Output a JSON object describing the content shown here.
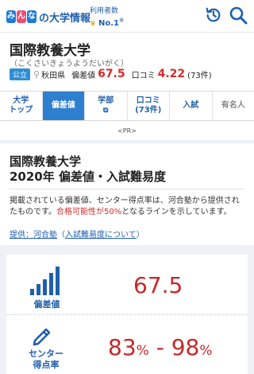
{
  "header": {
    "logo_glyphs": [
      "み",
      "ん",
      "な",
      "の"
    ],
    "logo_text": "の大学情報",
    "rank_line1": "利用者数",
    "rank_line2": "No.1",
    "rank_sup": "※"
  },
  "university": {
    "name": "国際教養大学",
    "kana": "（こくさいきょうようだいがく）",
    "type_badge": "公立",
    "location": "秋田県",
    "hensachi_label": "偏差値",
    "hensachi_value": "67.5",
    "kuchikomi_label": "口コミ",
    "kuchikomi_value": "4.22",
    "kuchikomi_count": "(73件)"
  },
  "tabs": [
    {
      "line1": "大学",
      "line2": "トップ"
    },
    {
      "line1": "偏差値",
      "line2": ""
    },
    {
      "line1": "学部",
      "line2": ""
    },
    {
      "line1": "口コミ",
      "line2": "(73件)"
    },
    {
      "line1": "入試",
      "line2": ""
    },
    {
      "line1": "有名人",
      "line2": ""
    }
  ],
  "pr_label": "<PR>",
  "section": {
    "title_line1": "国際教養大学",
    "title_line2": "2020年 偏差値・入試難易度",
    "desc_part1": "掲載されている偏差値、センター得点率は、河合塾から提供されたものです。",
    "desc_red": "合格可能性が50%",
    "desc_part2": "となるラインを示しています。",
    "link_source": "提供：河合塾",
    "link_about_open": "（",
    "link_about": "入試難易度について",
    "link_about_close": "）"
  },
  "stats": {
    "hensachi_label": "偏差値",
    "hensachi_value": "67.5",
    "center_label_line1": "センター",
    "center_label_line2": "得点率",
    "center_low": "83",
    "center_high": "98",
    "percent_sign": "%",
    "range_sep": " - "
  },
  "colors": {
    "brand_blue": "#1f5fae",
    "active_tab": "#2f7fd0",
    "accent_red": "#d62b2b"
  }
}
